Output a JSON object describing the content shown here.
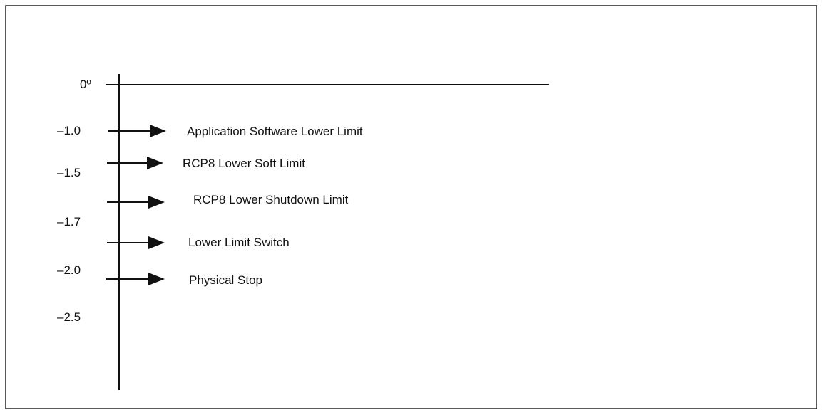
{
  "diagram": {
    "zero_label": "0º",
    "scale_labels": [
      "–1.0",
      "–1.5",
      "–1.7",
      "–2.0",
      "–2.5"
    ],
    "markers": [
      "Application Software Lower Limit",
      "RCP8 Lower Soft Limit",
      "RCP8 Lower Shutdown Limit",
      "Lower Limit Switch",
      "Physical Stop"
    ]
  }
}
